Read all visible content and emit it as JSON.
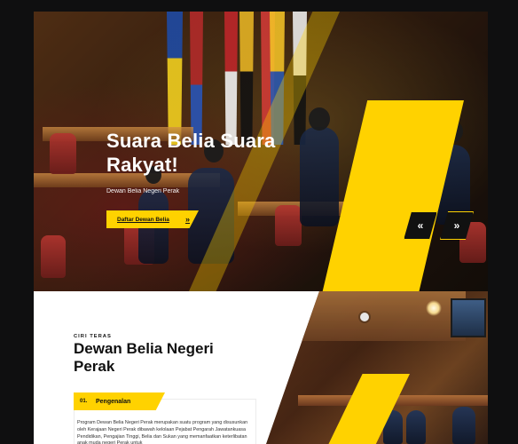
{
  "hero": {
    "title": "Suara Belia Suara Rakyat!",
    "subtitle": "Dewan Belia Negeri Perak",
    "cta_label": "Daftar Dewan Belia",
    "cta_arrow": "»",
    "prev_label": "«",
    "next_label": "»"
  },
  "section": {
    "kicker": "CIRI TERAS",
    "title": "Dewan Belia Negeri Perak"
  },
  "feature": {
    "number": "01.",
    "label": "Pengenalan",
    "text": "Program Dewan Belia Negeri Perak merupakan suatu program yang disusunkan oleh Kerajaan Negeri Perak dibawah kelolaan Pejabat Pengarah Jawatankuasa Pendidikan, Pengajian Tinggi, Belia dan Sukan yang memanfaatkan keterlibatan anak muda negeri Perak untuk"
  },
  "colors": {
    "accent": "#ffd200",
    "dark": "#111111",
    "white": "#ffffff"
  }
}
